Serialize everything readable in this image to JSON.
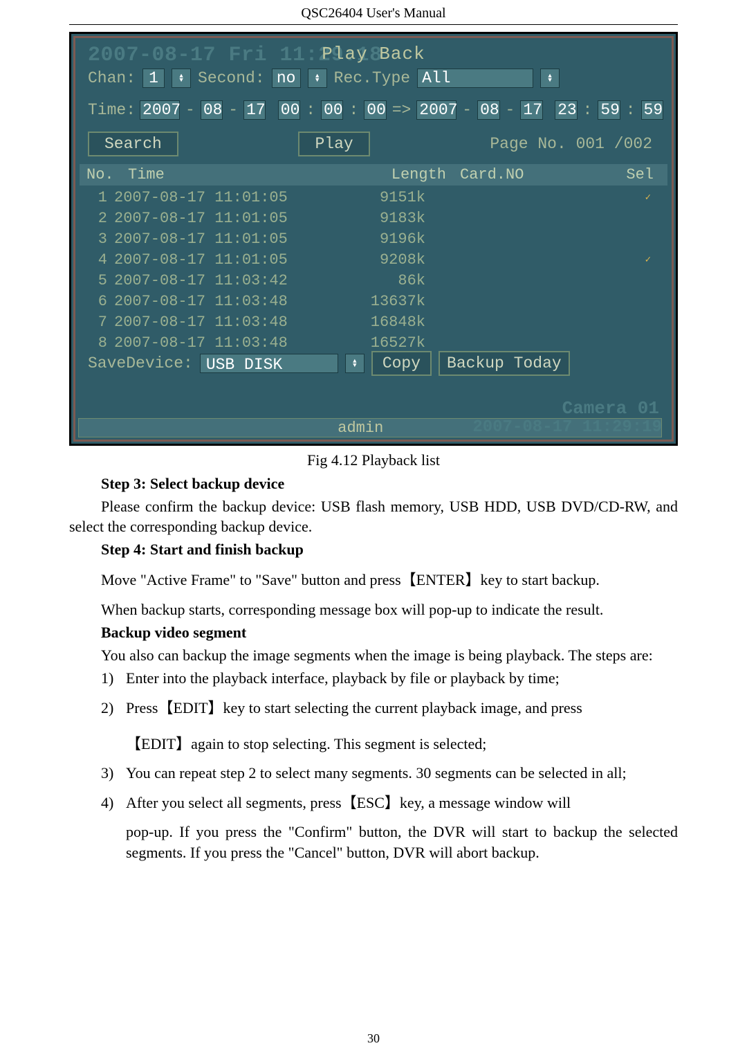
{
  "header": "QSC26404 User's Manual",
  "screen": {
    "ghost_date": "2007-08-17 Fri 11:29:18",
    "title": "Play Back",
    "chan_label": "Chan:",
    "chan_value": "1",
    "second_label": "Second:",
    "second_value": "no",
    "rectype_label": "Rec.Type",
    "rectype_value": "All",
    "time_label": "Time:",
    "time_from": {
      "y": "2007",
      "m": "08",
      "d": "17",
      "hh": "00",
      "mm": "00",
      "ss": "00"
    },
    "time_to": {
      "y": "2007",
      "m": "08",
      "d": "17",
      "hh": "23",
      "mm": "59",
      "ss": "59"
    },
    "arrow": "=>",
    "btn_search": "Search",
    "btn_play": "Play",
    "page_info": "Page No. 001 /002",
    "cols": {
      "no": "No.",
      "time": "Time",
      "len": "Length",
      "card": "Card.NO",
      "sel": "Sel"
    },
    "rows": [
      {
        "no": "1",
        "time": "2007-08-17 11:01:05",
        "len": "9151k",
        "card": "",
        "sel": "✓"
      },
      {
        "no": "2",
        "time": "2007-08-17 11:01:05",
        "len": "9183k",
        "card": "",
        "sel": ""
      },
      {
        "no": "3",
        "time": "2007-08-17 11:01:05",
        "len": "9196k",
        "card": "",
        "sel": ""
      },
      {
        "no": "4",
        "time": "2007-08-17 11:01:05",
        "len": "9208k",
        "card": "",
        "sel": "✓"
      },
      {
        "no": "5",
        "time": "2007-08-17 11:03:42",
        "len": "86k",
        "card": "",
        "sel": ""
      },
      {
        "no": "6",
        "time": "2007-08-17 11:03:48",
        "len": "13637k",
        "card": "",
        "sel": ""
      },
      {
        "no": "7",
        "time": "2007-08-17 11:03:48",
        "len": "16848k",
        "card": "",
        "sel": ""
      },
      {
        "no": "8",
        "time": "2007-08-17 11:03:48",
        "len": "16527k",
        "card": "",
        "sel": ""
      }
    ],
    "save_label": "SaveDevice:",
    "save_value": "USB DISK",
    "btn_copy": "Copy",
    "btn_backup": "Backup Today",
    "camera_label": "Camera 01",
    "status_user": "admin",
    "status_ts": "2007-08-17 11:29:19"
  },
  "caption": "Fig 4.12 Playback list",
  "body": {
    "step3_h": "Step 3: Select backup device",
    "step3_p": "Please confirm the backup device: USB flash memory, USB HDD, USB DVD/CD-RW, and select the corresponding backup device.",
    "step4_h": "Step 4: Start and finish backup",
    "step4_p1": "Move \"Active Frame\" to \"Save\" button and press【ENTER】key to start backup.",
    "step4_p2": "When backup starts, corresponding message box will pop-up to indicate the result.",
    "bvs_h": "Backup video segment",
    "bvs_p": "You also can backup the image segments when the image is being playback. The steps are:",
    "li1": "Enter into the playback interface, playback by file or playback by time;",
    "li2": "Press【EDIT】key to start selecting the current playback image, and press",
    "li2b": "【EDIT】again to stop selecting. This segment is selected;",
    "li3": "You can repeat step 2 to select many segments. 30 segments can be selected in all;",
    "li4": "After you select all segments, press【ESC】key, a message window will",
    "li4b": "pop-up. If you press the \"Confirm\" button, the DVR will start to backup the selected segments. If you press the \"Cancel\" button, DVR will abort backup."
  },
  "page_num": "30"
}
